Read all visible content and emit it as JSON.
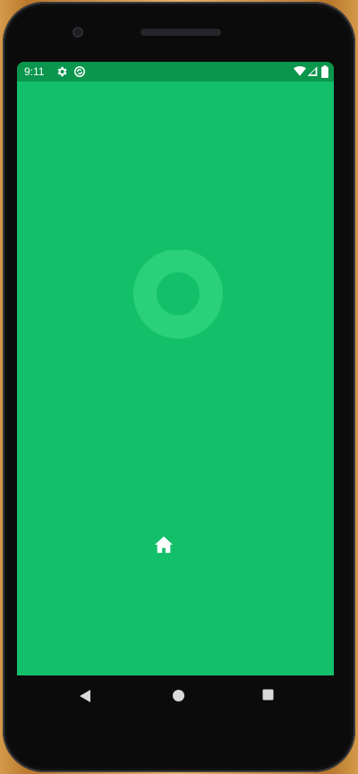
{
  "status_bar": {
    "time": "9:11",
    "left_icons": [
      "settings-icon",
      "sync-circle-icon"
    ],
    "right_icons": [
      "wifi-icon",
      "signal-icon",
      "battery-icon"
    ]
  },
  "screen": {
    "background_color": "#14bf6a",
    "status_bar_color": "#0a964c",
    "loader": "ring-spinner-icon",
    "center_icon": "home-icon"
  },
  "nav_bar": {
    "buttons": [
      "back-icon",
      "home-circle-icon",
      "recents-square-icon"
    ]
  }
}
